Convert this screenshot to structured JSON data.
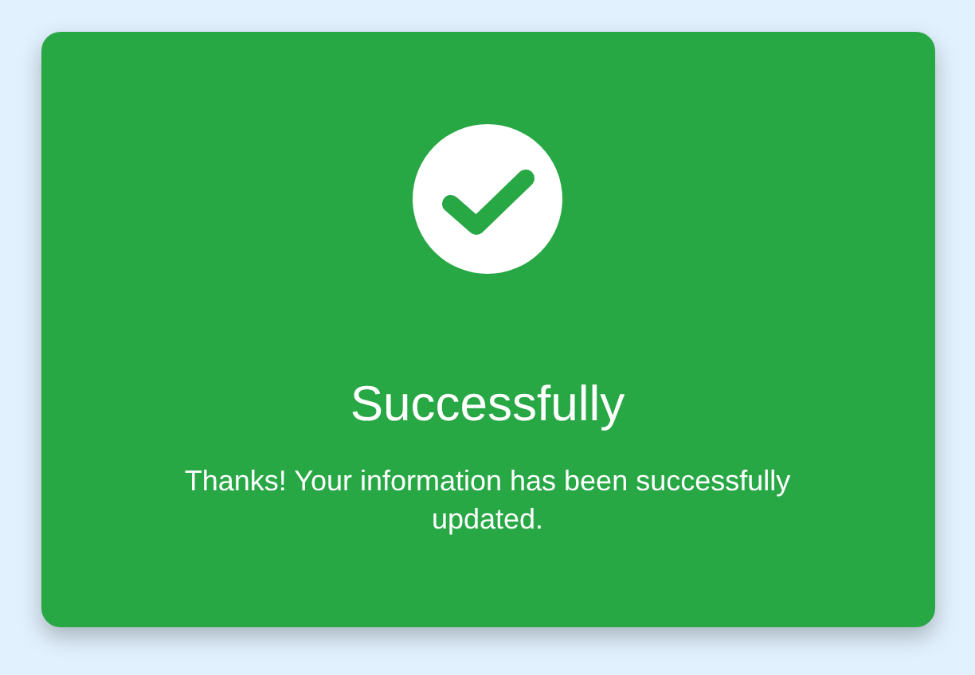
{
  "dialog": {
    "title": "Successfully",
    "message": "Thanks! Your information has been successfully updated."
  }
}
